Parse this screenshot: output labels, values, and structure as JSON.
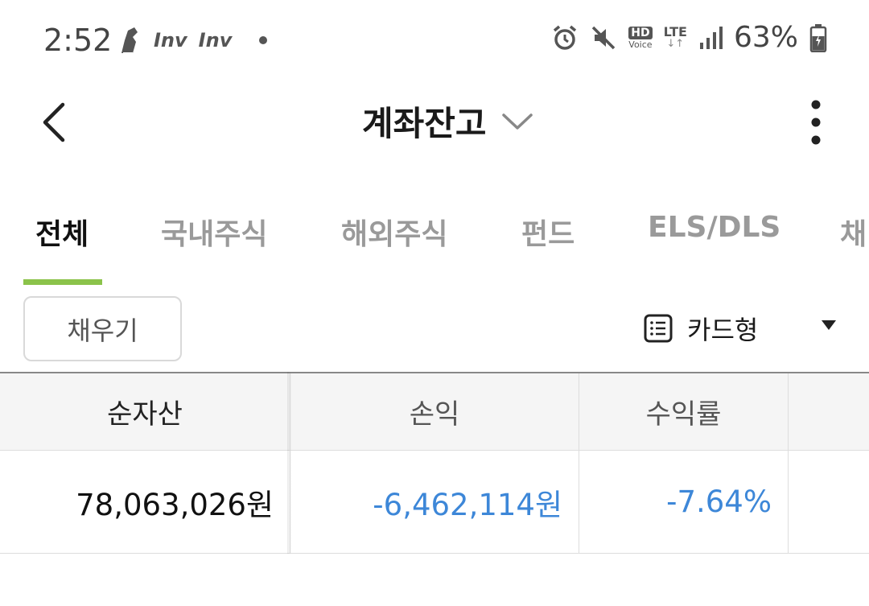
{
  "status_bar": {
    "time": "2:52",
    "apps": [
      "Inv",
      "Inv"
    ],
    "battery": "63%"
  },
  "header": {
    "title": "계좌잔고"
  },
  "tabs": [
    {
      "label": "전체",
      "active": true
    },
    {
      "label": "국내주식",
      "active": false
    },
    {
      "label": "해외주식",
      "active": false
    },
    {
      "label": "펀드",
      "active": false
    },
    {
      "label": "ELS/DLS",
      "active": false
    },
    {
      "label": "채",
      "active": false
    }
  ],
  "controls": {
    "fill_button": "채우기",
    "view_mode": "카드형"
  },
  "table": {
    "headers": [
      "순자산",
      "손익",
      "수익률"
    ],
    "row": {
      "net_assets": "78,063,026원",
      "profit_loss": "-6,462,114원",
      "return_rate": "-7.64%"
    }
  },
  "colors": {
    "accent": "#8bc34a",
    "negative": "#3d87d8"
  },
  "icons": [
    "sneaker-icon",
    "alarm-icon",
    "mute-icon",
    "signal-icon",
    "battery-icon",
    "back-icon",
    "chevron-down-icon",
    "more-icon",
    "list-icon",
    "triangle-down-icon"
  ]
}
